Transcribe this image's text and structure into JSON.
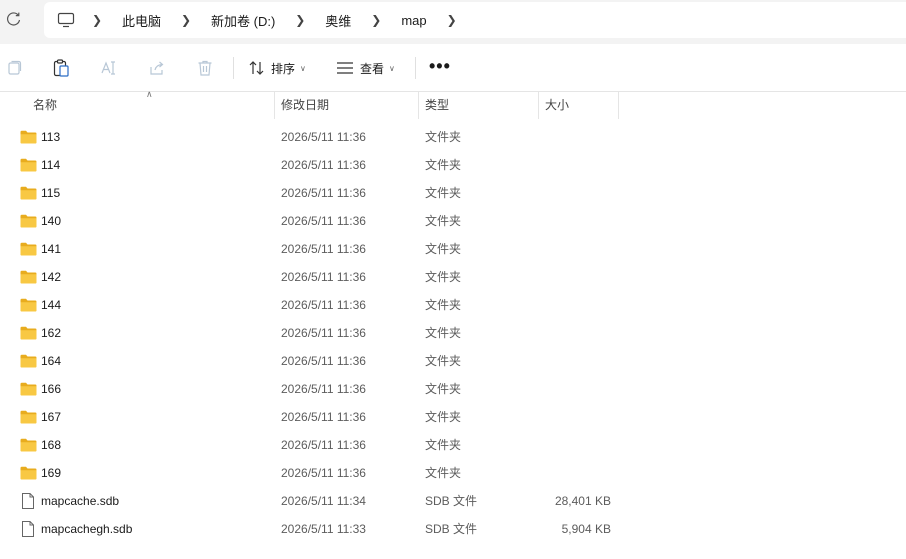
{
  "address_bar": {
    "breadcrumbs": [
      "此电脑",
      "新加卷 (D:)",
      "奥维",
      "map"
    ]
  },
  "toolbar": {
    "sort_label": "排序",
    "view_label": "查看",
    "more_label": "•••"
  },
  "columns": {
    "name": "名称",
    "date": "修改日期",
    "type": "类型",
    "size": "大小"
  },
  "files": [
    {
      "name": "113",
      "date": "2026/5/11 11:36",
      "type": "文件夹",
      "size": "",
      "icon": "folder-icon"
    },
    {
      "name": "114",
      "date": "2026/5/11 11:36",
      "type": "文件夹",
      "size": "",
      "icon": "folder-icon"
    },
    {
      "name": "115",
      "date": "2026/5/11 11:36",
      "type": "文件夹",
      "size": "",
      "icon": "folder-icon"
    },
    {
      "name": "140",
      "date": "2026/5/11 11:36",
      "type": "文件夹",
      "size": "",
      "icon": "folder-icon"
    },
    {
      "name": "141",
      "date": "2026/5/11 11:36",
      "type": "文件夹",
      "size": "",
      "icon": "folder-icon"
    },
    {
      "name": "142",
      "date": "2026/5/11 11:36",
      "type": "文件夹",
      "size": "",
      "icon": "folder-icon"
    },
    {
      "name": "144",
      "date": "2026/5/11 11:36",
      "type": "文件夹",
      "size": "",
      "icon": "folder-icon"
    },
    {
      "name": "162",
      "date": "2026/5/11 11:36",
      "type": "文件夹",
      "size": "",
      "icon": "folder-icon"
    },
    {
      "name": "164",
      "date": "2026/5/11 11:36",
      "type": "文件夹",
      "size": "",
      "icon": "folder-icon"
    },
    {
      "name": "166",
      "date": "2026/5/11 11:36",
      "type": "文件夹",
      "size": "",
      "icon": "folder-icon"
    },
    {
      "name": "167",
      "date": "2026/5/11 11:36",
      "type": "文件夹",
      "size": "",
      "icon": "folder-icon"
    },
    {
      "name": "168",
      "date": "2026/5/11 11:36",
      "type": "文件夹",
      "size": "",
      "icon": "folder-icon"
    },
    {
      "name": "169",
      "date": "2026/5/11 11:36",
      "type": "文件夹",
      "size": "",
      "icon": "folder-icon"
    },
    {
      "name": "mapcache.sdb",
      "date": "2026/5/11 11:34",
      "type": "SDB 文件",
      "size": "28,401 KB",
      "icon": "file-icon"
    },
    {
      "name": "mapcachegh.sdb",
      "date": "2026/5/11 11:33",
      "type": "SDB 文件",
      "size": "5,904 KB",
      "icon": "file-icon"
    }
  ],
  "colors": {
    "folder": "#f8c843",
    "folder_dark": "#e8ac1e",
    "chrome_bg": "#f3f3f3"
  }
}
